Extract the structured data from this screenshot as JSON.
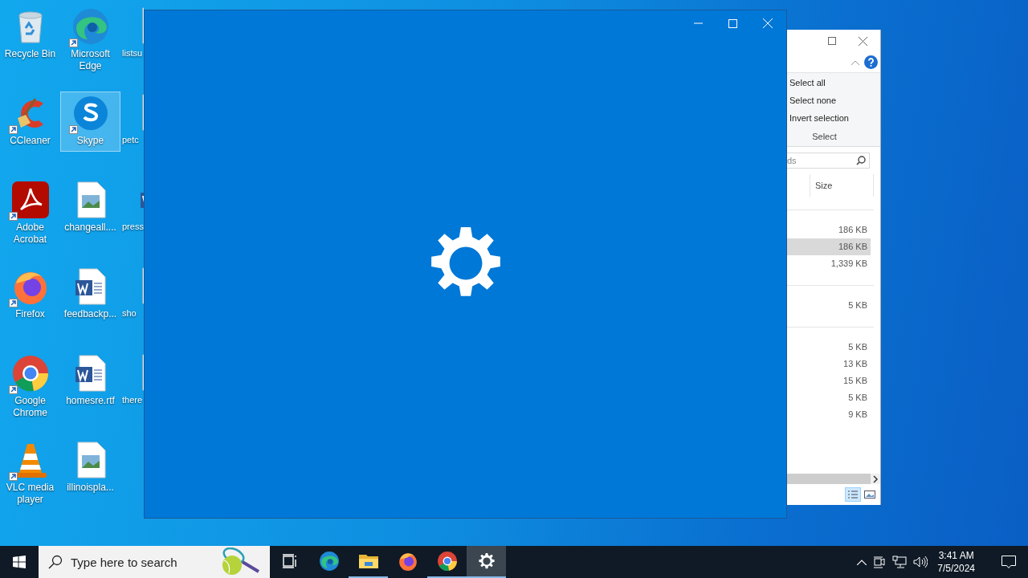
{
  "desktop_icons": [
    {
      "label": "Recycle Bin",
      "kind": "recycle",
      "shortcut": false,
      "selected": false
    },
    {
      "label": "CCleaner",
      "kind": "ccleaner",
      "shortcut": true,
      "selected": false
    },
    {
      "label": "Adobe Acrobat",
      "kind": "acrobat",
      "shortcut": true,
      "selected": false
    },
    {
      "label": "Firefox",
      "kind": "firefox",
      "shortcut": true,
      "selected": false
    },
    {
      "label": "Google Chrome",
      "kind": "chrome",
      "shortcut": true,
      "selected": false
    },
    {
      "label": "VLC media player",
      "kind": "vlc",
      "shortcut": true,
      "selected": false
    },
    {
      "label": "Microsoft Edge",
      "kind": "edge",
      "shortcut": true,
      "selected": false
    },
    {
      "label": "Skype",
      "kind": "skype",
      "shortcut": true,
      "selected": true
    },
    {
      "label": "changeall....",
      "kind": "image",
      "shortcut": false,
      "selected": false
    },
    {
      "label": "feedbackp...",
      "kind": "word",
      "shortcut": false,
      "selected": false
    },
    {
      "label": "homesre.rtf",
      "kind": "word",
      "shortcut": false,
      "selected": false
    },
    {
      "label": "illinoispla...",
      "kind": "image",
      "shortcut": false,
      "selected": false
    },
    {
      "label": "listsu",
      "kind": "image",
      "shortcut": false,
      "selected": false
    },
    {
      "label": "petc",
      "kind": "image",
      "shortcut": false,
      "selected": false
    },
    {
      "label": "press",
      "kind": "word",
      "shortcut": false,
      "selected": false
    },
    {
      "label": "sho",
      "kind": "image",
      "shortcut": false,
      "selected": false
    },
    {
      "label": "there",
      "kind": "image",
      "shortcut": false,
      "selected": false
    }
  ],
  "explorer": {
    "ribbon_buttons": [
      "Select all",
      "Select none",
      "Invert selection"
    ],
    "ribbon_group": "Select",
    "search_placeholder": "ds",
    "column_header": "Size",
    "groups": [
      {
        "rows": [
          {
            "size": "186 KB",
            "selected": false
          },
          {
            "size": "186 KB",
            "selected": true
          },
          {
            "size": "1,339 KB",
            "selected": false
          }
        ]
      },
      {
        "rows": [
          {
            "size": "5 KB",
            "selected": false
          }
        ]
      },
      {
        "rows": [
          {
            "size": "5 KB",
            "selected": false
          },
          {
            "size": "13 KB",
            "selected": false
          },
          {
            "size": "15 KB",
            "selected": false
          },
          {
            "size": "5 KB",
            "selected": false
          },
          {
            "size": "9 KB",
            "selected": false
          }
        ]
      }
    ]
  },
  "settings_window": {
    "kind": "splash"
  },
  "taskbar": {
    "search_placeholder": "Type here to search",
    "apps": [
      {
        "kind": "taskview",
        "running": false,
        "active": false
      },
      {
        "kind": "edge",
        "running": false,
        "active": false
      },
      {
        "kind": "folder",
        "running": true,
        "active": false
      },
      {
        "kind": "firefox",
        "running": false,
        "active": false
      },
      {
        "kind": "chrome",
        "running": true,
        "active": false
      },
      {
        "kind": "gear",
        "running": true,
        "active": true
      }
    ],
    "time": "3:41 AM",
    "date": "7/5/2024"
  }
}
